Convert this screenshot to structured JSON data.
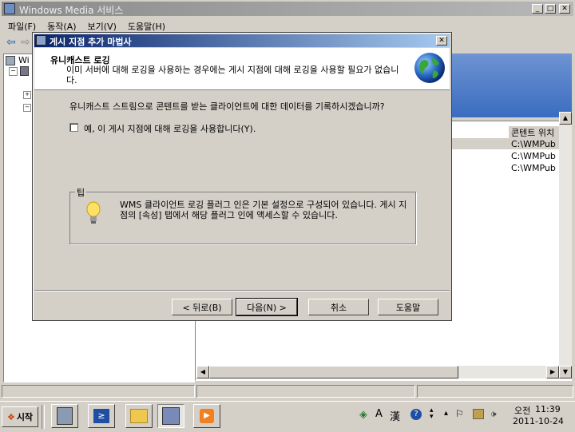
{
  "main_window": {
    "title": "Windows Media 서비스",
    "menu": [
      "파일(F)",
      "동작(A)",
      "보기(V)",
      "도움말(H)"
    ],
    "tree_fragment": "Wi",
    "list_column_header": "콘텐트 위치",
    "list_rows": [
      "C:\\WMPub",
      "C:\\WMPub",
      "C:\\WMPub"
    ]
  },
  "wizard": {
    "title": "게시 지점 추가 마법사",
    "header_title": "유니캐스트 로깅",
    "header_desc": "이미 서버에 대해 로깅을 사용하는 경우에는 게시 지점에 대해 로깅을 사용할 필요가 없습니다.",
    "question": "유니캐스트 스트림으로 콘텐트를 받는 클라이언트에 대한 데이터를 기록하시겠습니까?",
    "checkbox_label": "예, 이 게시 지점에 대해 로깅을 사용합니다(Y).",
    "checkbox_checked": false,
    "tip_legend": "팁",
    "tip_text": "WMS 클라이언트 로깅 플러그 인은 기본 설정으로 구성되어 있습니다. 게시 지점의 [속성] 탭에서 해당 플러그 인에 액세스할 수 있습니다.",
    "buttons": {
      "back": "< 뒤로(B)",
      "next": "다음(N) >",
      "cancel": "취소",
      "help": "도움말"
    }
  },
  "taskbar": {
    "start_label": "시작",
    "clock_ampm": "오전",
    "clock_time": "11:39",
    "clock_date": "2011-10-24",
    "ime_label": "A",
    "hanja_label": "漢"
  },
  "colors": {
    "title_active": "#0a246a",
    "face": "#d4d0c8",
    "dialog_face": "#d4d0c8"
  }
}
